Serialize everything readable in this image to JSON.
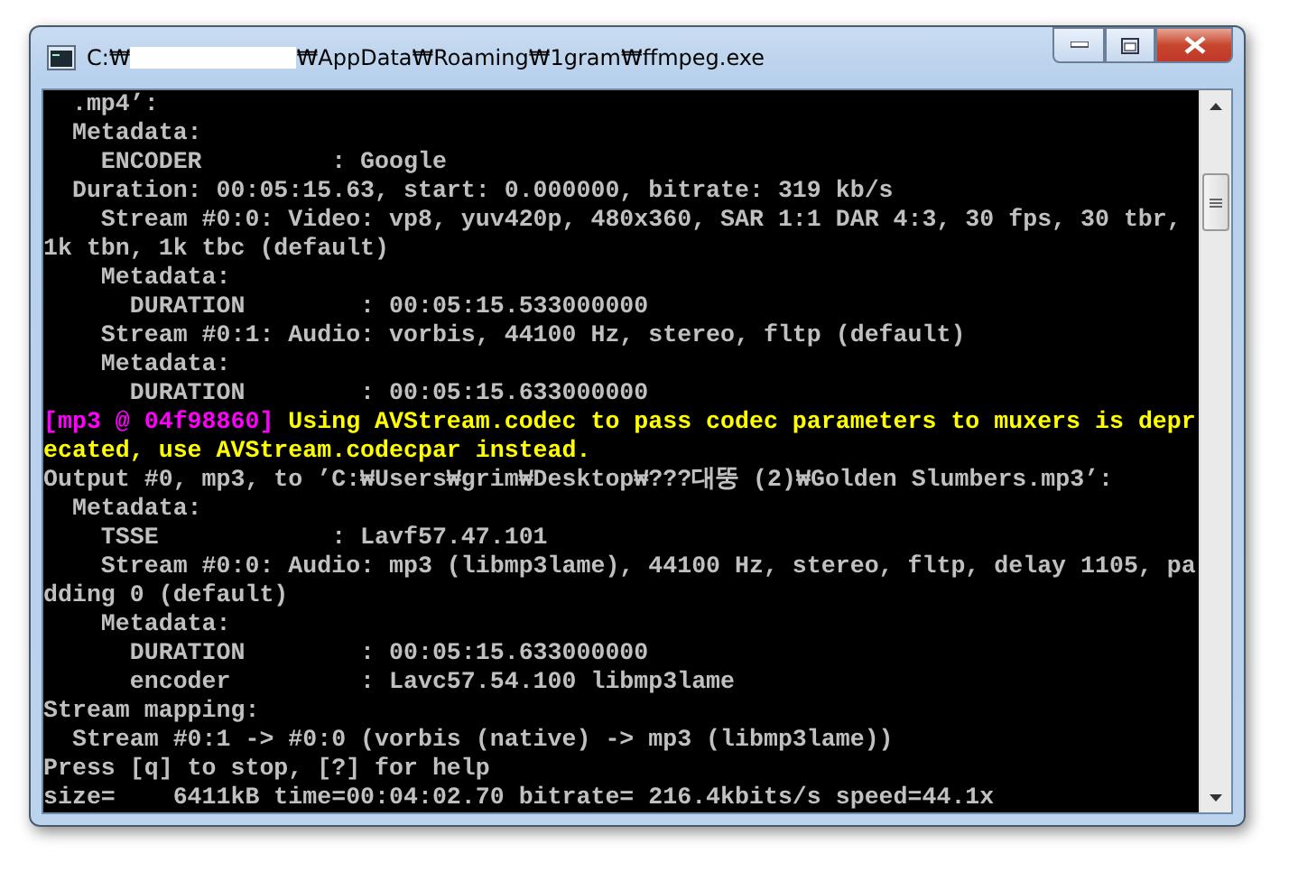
{
  "window": {
    "title_parts": [
      "C:₩",
      "₩AppData₩Roaming₩1gram₩ffmpeg.exe"
    ]
  },
  "console": {
    "lines": [
      {
        "kind": "info",
        "text": "  .mp4’:"
      },
      {
        "kind": "info",
        "text": "  Metadata:"
      },
      {
        "kind": "info",
        "text": "    ENCODER         : Google"
      },
      {
        "kind": "info",
        "text": "  Duration: 00:05:15.63, start: 0.000000, bitrate: 319 kb/s"
      },
      {
        "kind": "info",
        "text": "    Stream #0:0: Video: vp8, yuv420p, 480x360, SAR 1:1 DAR 4:3, 30 fps, 30 tbr,"
      },
      {
        "kind": "info",
        "text": "1k tbn, 1k tbc (default)"
      },
      {
        "kind": "info",
        "text": "    Metadata:"
      },
      {
        "kind": "info",
        "text": "      DURATION        : 00:05:15.533000000"
      },
      {
        "kind": "info",
        "text": "    Stream #0:1: Audio: vorbis, 44100 Hz, stereo, fltp (default)"
      },
      {
        "kind": "info",
        "text": "    Metadata:"
      },
      {
        "kind": "info",
        "text": "      DURATION        : 00:05:15.633000000"
      },
      {
        "kind": "warning",
        "tag": "[mp3 @ 04f98860]",
        "text": " Using AVStream.codec to pass codec parameters to muxers is depr"
      },
      {
        "kind": "warning",
        "text": "ecated, use AVStream.codecpar instead."
      },
      {
        "kind": "info",
        "text": "Output #0, mp3, to ’C:₩Users₩grim₩Desktop₩???대뚱 (2)₩Golden Slumbers.mp3’:"
      },
      {
        "kind": "info",
        "text": "  Metadata:"
      },
      {
        "kind": "info",
        "text": "    TSSE            : Lavf57.47.101"
      },
      {
        "kind": "info",
        "text": "    Stream #0:0: Audio: mp3 (libmp3lame), 44100 Hz, stereo, fltp, delay 1105, pa"
      },
      {
        "kind": "info",
        "text": "dding 0 (default)"
      },
      {
        "kind": "info",
        "text": "    Metadata:"
      },
      {
        "kind": "info",
        "text": "      DURATION        : 00:05:15.633000000"
      },
      {
        "kind": "info",
        "text": "      encoder         : Lavc57.54.100 libmp3lame"
      },
      {
        "kind": "info",
        "text": "Stream mapping:"
      },
      {
        "kind": "info",
        "text": "  Stream #0:1 -> #0:0 (vorbis (native) -> mp3 (libmp3lame))"
      },
      {
        "kind": "info",
        "text": "Press [q] to stop, [?] for help"
      },
      {
        "kind": "info",
        "text": "size=    6411kB time=00:04:02.70 bitrate= 216.4kbits/s speed=44.1x"
      }
    ]
  }
}
